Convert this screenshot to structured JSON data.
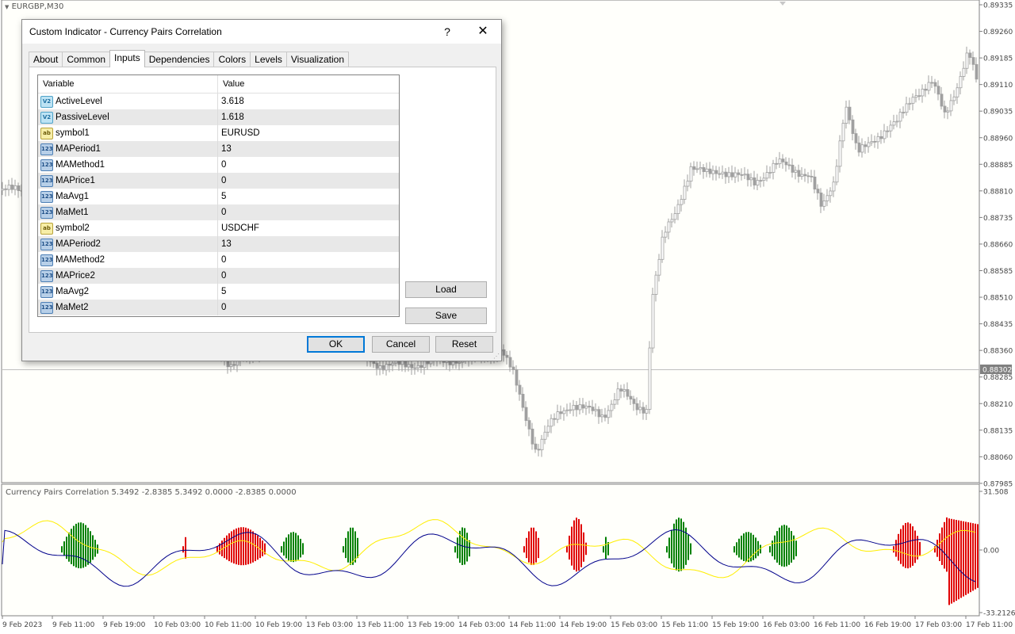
{
  "chart": {
    "symbol_label": "EURGBP,M30",
    "current_price": "0.88302",
    "price_scale": [
      "0.89335",
      "0.89260",
      "0.89185",
      "0.89110",
      "0.89035",
      "0.88960",
      "0.88885",
      "0.88810",
      "0.88735",
      "0.88660",
      "0.88585",
      "0.88510",
      "0.88435",
      "0.88360",
      "0.88285",
      "0.88210",
      "0.88135",
      "0.88060",
      "0.87985"
    ],
    "indicator_label": "Currency Pairs Correlation 5.3492 -2.8385 5.3492 0.0000 -2.8385 0.0000",
    "indicator_scale": [
      "31.508",
      "0.00",
      "-33.2126"
    ],
    "time_axis": [
      "9 Feb 2023",
      "9 Feb 11:00",
      "9 Feb 19:00",
      "10 Feb 03:00",
      "10 Feb 11:00",
      "10 Feb 19:00",
      "13 Feb 03:00",
      "13 Feb 11:00",
      "13 Feb 19:00",
      "14 Feb 03:00",
      "14 Feb 11:00",
      "14 Feb 19:00",
      "15 Feb 03:00",
      "15 Feb 11:00",
      "15 Feb 19:00",
      "16 Feb 03:00",
      "16 Feb 11:00",
      "16 Feb 19:00",
      "17 Feb 03:00",
      "17 Feb 11:00"
    ],
    "colors": {
      "bull_hist": "#008000",
      "bear_hist": "#e00000",
      "line1": "#ffee00",
      "line2": "#00008b",
      "candle": "#a0a0a0"
    }
  },
  "dialog": {
    "title": "Custom Indicator - Currency Pairs Correlation",
    "help": "?",
    "close": "✕",
    "tabs": [
      "About",
      "Common",
      "Inputs",
      "Dependencies",
      "Colors",
      "Levels",
      "Visualization"
    ],
    "active_tab": "Inputs",
    "columns": {
      "variable": "Variable",
      "value": "Value"
    },
    "params": [
      {
        "name": "ActiveLevel",
        "value": "3.618",
        "type": "double",
        "icon": "V2"
      },
      {
        "name": "PassiveLevel",
        "value": "1.618",
        "type": "double",
        "icon": "V2"
      },
      {
        "name": "symbol1",
        "value": "EURUSD",
        "type": "string",
        "icon": "ab"
      },
      {
        "name": "MAPeriod1",
        "value": "13",
        "type": "int",
        "icon": "123"
      },
      {
        "name": "MAMethod1",
        "value": "0",
        "type": "int",
        "icon": "123"
      },
      {
        "name": "MAPrice1",
        "value": "0",
        "type": "int",
        "icon": "123"
      },
      {
        "name": "MaAvg1",
        "value": "5",
        "type": "int",
        "icon": "123"
      },
      {
        "name": "MaMet1",
        "value": "0",
        "type": "int",
        "icon": "123"
      },
      {
        "name": "symbol2",
        "value": "USDCHF",
        "type": "string",
        "icon": "ab"
      },
      {
        "name": "MAPeriod2",
        "value": "13",
        "type": "int",
        "icon": "123"
      },
      {
        "name": "MAMethod2",
        "value": "0",
        "type": "int",
        "icon": "123"
      },
      {
        "name": "MAPrice2",
        "value": "0",
        "type": "int",
        "icon": "123"
      },
      {
        "name": "MaAvg2",
        "value": "5",
        "type": "int",
        "icon": "123"
      },
      {
        "name": "MaMet2",
        "value": "0",
        "type": "int",
        "icon": "123"
      }
    ],
    "buttons": {
      "load": "Load",
      "save": "Save",
      "ok": "OK",
      "cancel": "Cancel",
      "reset": "Reset"
    }
  }
}
